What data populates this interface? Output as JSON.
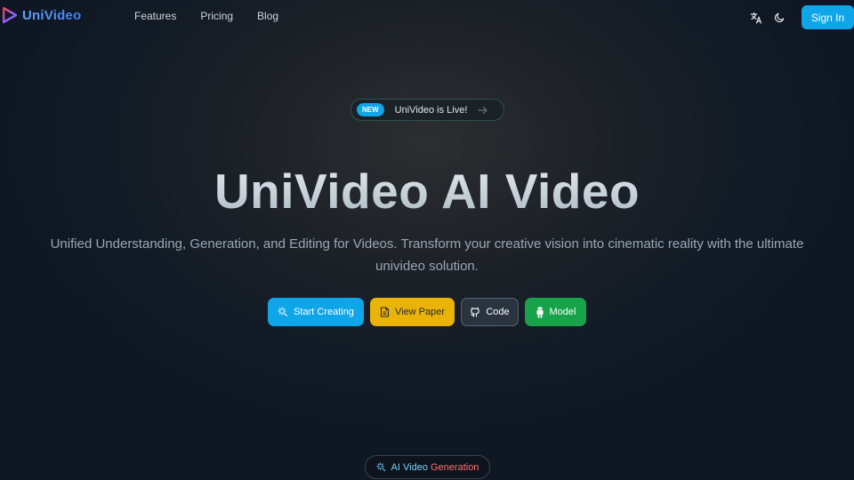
{
  "nav": {
    "logo_text": "UniVideo",
    "links": [
      "Features",
      "Pricing",
      "Blog"
    ],
    "language_icon": "translate-icon",
    "theme_icon": "moon-icon",
    "signin_label": "Sign In"
  },
  "badge": {
    "tag": "NEW",
    "text": "UniVideo is Live!",
    "icon": "arrow-right-icon"
  },
  "hero": {
    "title": "UniVideo AI Video",
    "subtitle": "Unified Understanding, Generation, and Editing for Videos. Transform your creative vision into cinematic reality with the ultimate univideo solution."
  },
  "cta": {
    "start": {
      "label": "Start Creating",
      "icon": "sparkle-icon"
    },
    "paper": {
      "label": "View Paper",
      "icon": "document-icon"
    },
    "code": {
      "label": "Code",
      "icon": "github-icon"
    },
    "model": {
      "label": "Model",
      "icon": "huggingface-icon"
    }
  },
  "section_pill": {
    "label_a": "AI Video",
    "label_b": "Generation",
    "icon": "sparkle-icon"
  },
  "colors": {
    "accent": "#0ea5e9",
    "paper": "#eab308",
    "code": "#2a3340",
    "model": "#16a34a"
  }
}
